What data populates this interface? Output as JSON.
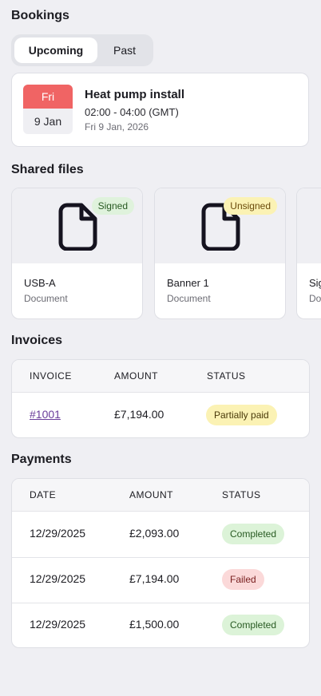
{
  "bookings": {
    "title": "Bookings",
    "tabs": {
      "upcoming": "Upcoming",
      "past": "Past"
    },
    "item": {
      "day": "Fri",
      "date": "9 Jan",
      "title": "Heat pump install",
      "time": "02:00 - 04:00 (GMT)",
      "full_date": "Fri 9 Jan, 2026"
    }
  },
  "shared_files": {
    "title": "Shared files",
    "files": [
      {
        "name": "USB-A",
        "type": "Document",
        "badge": "Signed"
      },
      {
        "name": "Banner 1",
        "type": "Document",
        "badge": "Unsigned"
      },
      {
        "name": "Sig",
        "type": "Do"
      }
    ]
  },
  "invoices": {
    "title": "Invoices",
    "headers": {
      "invoice": "INVOICE",
      "amount": "AMOUNT",
      "status": "STATUS"
    },
    "rows": [
      {
        "invoice": "#1001",
        "amount": "£7,194.00",
        "status": "Partially paid"
      }
    ]
  },
  "payments": {
    "title": "Payments",
    "headers": {
      "date": "DATE",
      "amount": "AMOUNT",
      "status": "STATUS"
    },
    "rows": [
      {
        "date": "12/29/2025",
        "amount": "£2,093.00",
        "status": "Completed"
      },
      {
        "date": "12/29/2025",
        "amount": "£7,194.00",
        "status": "Failed"
      },
      {
        "date": "12/29/2025",
        "amount": "£1,500.00",
        "status": "Completed"
      }
    ]
  },
  "colors": {
    "background": "#efeff3",
    "calendar_header": "#f06464",
    "badge_signed": "#dff2dc",
    "badge_unsigned": "#fbf2b4",
    "status_completed": "#dcf3d8",
    "status_failed": "#fbd9d9",
    "link": "#6a3d9a"
  }
}
